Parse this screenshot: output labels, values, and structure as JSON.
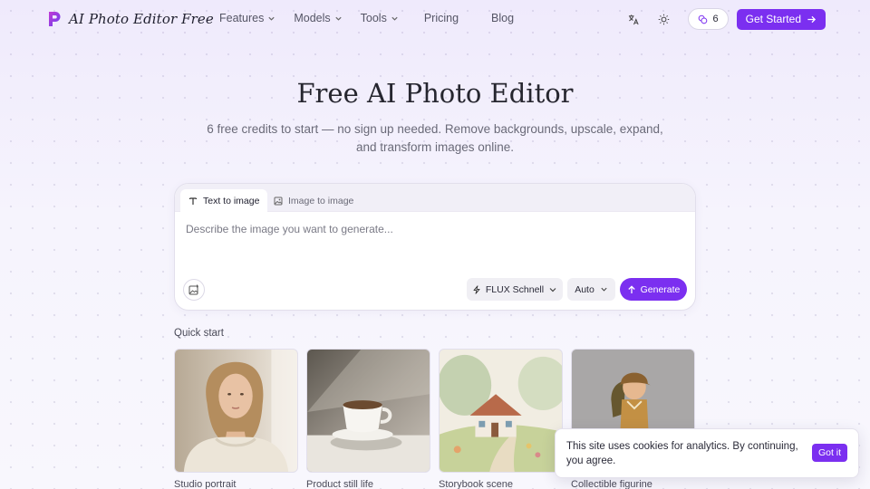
{
  "brand": {
    "name": "AI Photo Editor Free",
    "accent": "#7b2ff0"
  },
  "nav": {
    "links": [
      {
        "label": "Features",
        "dropdown": true
      },
      {
        "label": "Models",
        "dropdown": true
      },
      {
        "label": "Tools",
        "dropdown": true
      },
      {
        "label": "Pricing",
        "dropdown": false
      },
      {
        "label": "Blog",
        "dropdown": false
      }
    ],
    "translate_icon": "translate-icon",
    "theme_icon": "sun-icon",
    "credits_count": "6",
    "cta_label": "Get Started"
  },
  "hero": {
    "title": "Free AI Photo Editor",
    "subtitle": "6 free credits to start — no sign up needed. Remove backgrounds, upscale, expand, and transform images online."
  },
  "generator": {
    "tabs": [
      {
        "label": "Text to image",
        "active": true
      },
      {
        "label": "Image to image",
        "active": false
      }
    ],
    "prompt_value": "",
    "prompt_placeholder": "Describe the image you want to generate...",
    "model_label": "FLUX Schnell",
    "ratio_label": "Auto",
    "generate_label": "Generate"
  },
  "quick_start": {
    "label": "Quick start",
    "items": [
      {
        "caption": "Studio portrait"
      },
      {
        "caption": "Product still life"
      },
      {
        "caption": "Storybook scene"
      },
      {
        "caption": "Collectible figurine"
      }
    ]
  },
  "cookie": {
    "text": "This site uses cookies for analytics. By continuing, you agree.",
    "button_label": "Got it"
  }
}
